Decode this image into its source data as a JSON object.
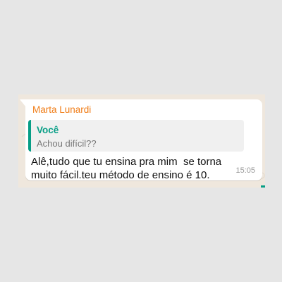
{
  "message": {
    "sender": "Marta Lunardi",
    "quoted": {
      "author": "Você",
      "text": "Achou difícil??"
    },
    "text": "Alê,tudo que tu ensina pra mim  se torna muito fácil.teu método de ensino é 10.",
    "time": "15:05"
  },
  "colors": {
    "sender": "#f07c16",
    "quote_accent": "#079e86",
    "chat_background": "#efe7dd",
    "page_background": "#e6e6e6"
  },
  "icons": [
    "chat-wallpaper-doodles-icon"
  ]
}
